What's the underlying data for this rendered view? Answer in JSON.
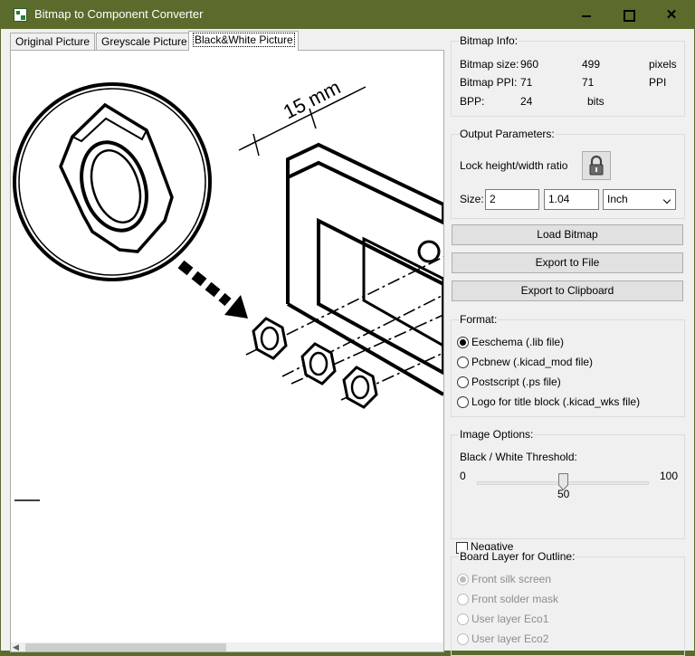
{
  "window": {
    "title": "Bitmap to Component Converter"
  },
  "tabs": [
    {
      "label": "Original Picture"
    },
    {
      "label": "Greyscale Picture"
    },
    {
      "label": "Black&White Picture"
    }
  ],
  "active_tab": "Black&White Picture",
  "image": {
    "dimension_label": "15 mm"
  },
  "bitmap_info": {
    "title": "Bitmap Info:",
    "size_label": "Bitmap size:",
    "size_x": "960",
    "size_y": "499",
    "size_unit": "pixels",
    "ppi_label": "Bitmap PPI:",
    "ppi_x": "71",
    "ppi_y": "71",
    "ppi_unit": "PPI",
    "bpp_label": "BPP:",
    "bpp_value": "24",
    "bpp_unit": "bits"
  },
  "output": {
    "title": "Output Parameters:",
    "lock_label": "Lock height/width ratio",
    "size_label": "Size:",
    "size_w": "2",
    "size_h": "1.04",
    "unit": "Inch"
  },
  "buttons": {
    "load": "Load Bitmap",
    "export_file": "Export to File",
    "export_clipboard": "Export to Clipboard"
  },
  "format": {
    "title": "Format:",
    "options": [
      {
        "label": "Eeschema (.lib file)",
        "checked": true
      },
      {
        "label": "Pcbnew (.kicad_mod file)",
        "checked": false
      },
      {
        "label": "Postscript (.ps file)",
        "checked": false
      },
      {
        "label": "Logo for title block (.kicad_wks file)",
        "checked": false
      }
    ]
  },
  "image_options": {
    "title": "Image Options:",
    "threshold_label": "Black / White Threshold:",
    "min": "0",
    "max": "100",
    "value": "50",
    "threshold_level": 0.5,
    "negative_label": "Negative",
    "negative_checked": false
  },
  "board_layer": {
    "title": "Board Layer for Outline:",
    "options": [
      {
        "label": "Front silk screen",
        "checked": true
      },
      {
        "label": "Front solder mask",
        "checked": false
      },
      {
        "label": "User layer Eco1",
        "checked": false
      },
      {
        "label": "User layer Eco2",
        "checked": false
      }
    ]
  }
}
